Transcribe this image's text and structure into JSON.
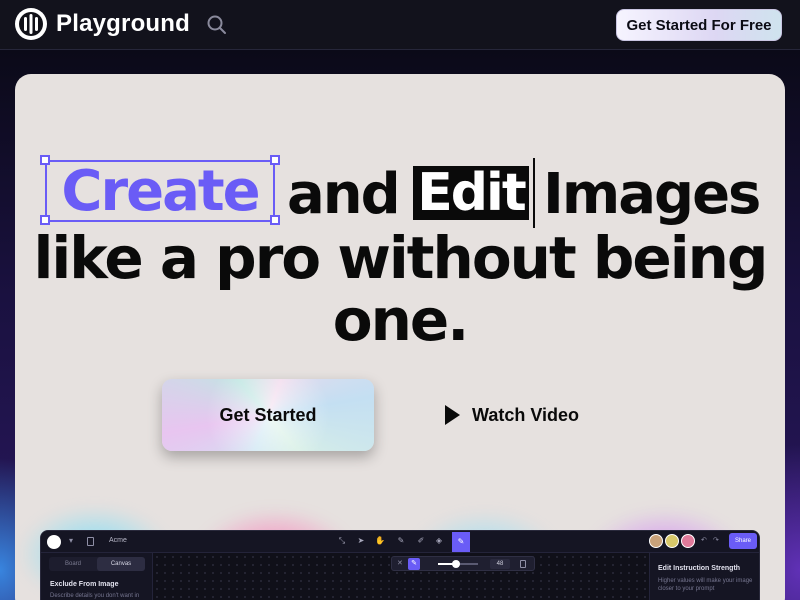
{
  "nav": {
    "brand": "Playground",
    "cta_label": "Get Started For Free",
    "logo_icon": "playground-logo-icon",
    "search_icon": "search-icon"
  },
  "hero": {
    "word_create": "Create",
    "word_and": "and",
    "word_edit": "Edit",
    "word_images": "Images",
    "line2": "like a pro without being",
    "line3": "one.",
    "primary_button": "Get Started",
    "secondary_button": "Watch Video",
    "accent_color": "#6a5cf6"
  },
  "preview": {
    "project_name": "Acme",
    "share_label": "Share",
    "tabs": [
      "Board",
      "Canvas"
    ],
    "active_tab": "Canvas",
    "left_panel_title": "Exclude From Image",
    "left_panel_sub": "Describe details you don't want in",
    "brush_size": "48",
    "brush_level": 0.45,
    "right_panel_title": "Edit Instruction Strength",
    "right_panel_sub": "Higher values will make your image closer to your prompt"
  }
}
